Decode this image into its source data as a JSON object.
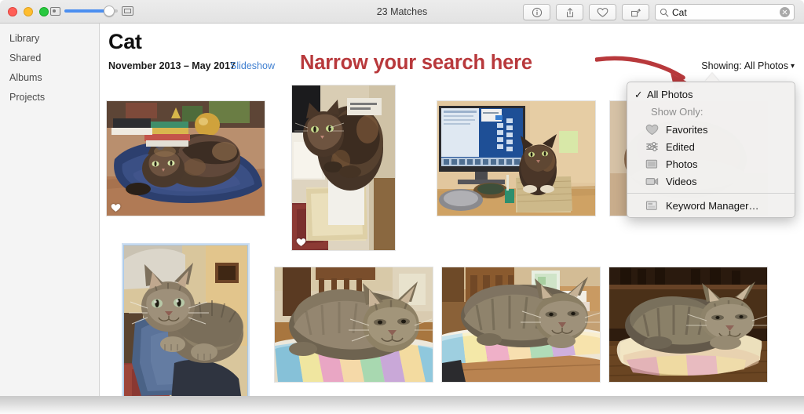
{
  "window": {
    "title": "23 Matches",
    "traffic_lights": [
      "close",
      "minimize",
      "maximize"
    ],
    "zoom_slider": {
      "value": 78,
      "small_icon": "small-thumbnail-icon",
      "large_icon": "large-thumbnail-icon"
    }
  },
  "toolbar": {
    "info_icon": "info-icon",
    "share_icon": "share-icon",
    "favorite_icon": "heart-icon",
    "rotate_icon": "rotate-icon",
    "search": {
      "icon": "search-icon",
      "value": "Cat",
      "placeholder": "Search",
      "clear_icon": "clear-icon"
    }
  },
  "sidebar": {
    "items": [
      {
        "label": "Library"
      },
      {
        "label": "Shared"
      },
      {
        "label": "Albums"
      },
      {
        "label": "Projects"
      }
    ]
  },
  "main": {
    "title": "Cat",
    "date_range": "November 2013 – May 2017",
    "slideshow_label": "Slideshow",
    "showing_label": "Showing:",
    "showing_value": "All Photos",
    "showing_caret": "chevron-down-icon"
  },
  "annotation": {
    "text": "Narrow your search here",
    "color": "#b8393c",
    "arrow": "curved-arrow-icon"
  },
  "dropdown": {
    "selected": "All Photos",
    "check_glyph": "✓",
    "items": [
      {
        "label": "All Photos",
        "checked": true,
        "icon": null,
        "type": "option"
      },
      {
        "label": "Show Only:",
        "checked": false,
        "icon": null,
        "type": "header"
      },
      {
        "label": "Favorites",
        "checked": false,
        "icon": "heart-icon",
        "type": "option"
      },
      {
        "label": "Edited",
        "checked": false,
        "icon": "sliders-icon",
        "type": "option"
      },
      {
        "label": "Photos",
        "checked": false,
        "icon": "photo-icon",
        "type": "option"
      },
      {
        "label": "Videos",
        "checked": false,
        "icon": "video-icon",
        "type": "option"
      },
      {
        "label": "Keyword Manager…",
        "checked": false,
        "icon": "keyword-document-icon",
        "type": "option"
      }
    ]
  },
  "photos": [
    {
      "name": "tortoiseshell-cat-on-blue-blanket",
      "favorite": true,
      "selected": false,
      "orientation": "landscape"
    },
    {
      "name": "tortoiseshell-cat-in-basket",
      "favorite": true,
      "selected": false,
      "orientation": "portrait"
    },
    {
      "name": "cat-by-computer-monitor",
      "favorite": false,
      "selected": false,
      "orientation": "landscape"
    },
    {
      "name": "cat-partially-hidden-by-menu",
      "favorite": false,
      "selected": false,
      "orientation": "landscape"
    },
    {
      "name": "tabby-cat-on-lap",
      "favorite": false,
      "selected": true,
      "orientation": "portrait"
    },
    {
      "name": "tabby-cat-on-striped-blanket",
      "favorite": false,
      "selected": false,
      "orientation": "landscape"
    },
    {
      "name": "tabby-cat-on-table-blanket",
      "favorite": false,
      "selected": false,
      "orientation": "landscape"
    },
    {
      "name": "tabby-cat-on-floor-blanket",
      "favorite": false,
      "selected": false,
      "orientation": "landscape"
    }
  ]
}
